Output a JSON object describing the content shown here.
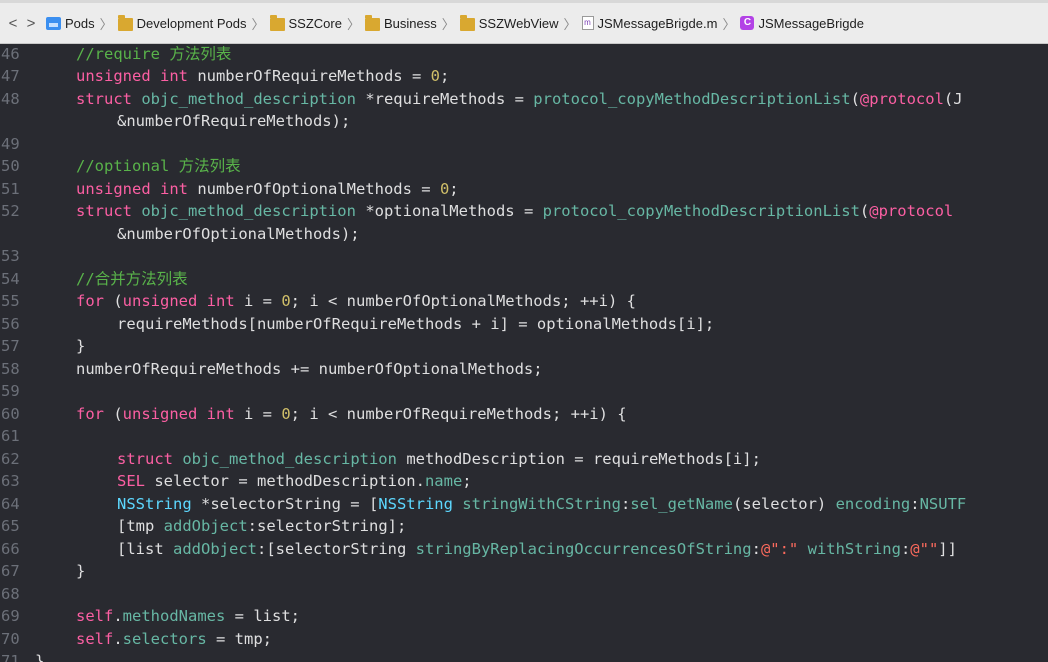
{
  "breadcrumb": {
    "back": "<",
    "forward": ">",
    "separator": "〉",
    "items": [
      {
        "label": "Pods",
        "icon": "project-icon"
      },
      {
        "label": "Development Pods",
        "icon": "folder-icon"
      },
      {
        "label": "SSZCore",
        "icon": "folder-icon"
      },
      {
        "label": "Business",
        "icon": "folder-icon"
      },
      {
        "label": "SSZWebView",
        "icon": "folder-icon"
      },
      {
        "label": "JSMessageBrigde.m",
        "icon": "objc-file-icon",
        "glyph": "m"
      },
      {
        "label": "JSMessageBrigde",
        "icon": "class-icon",
        "glyph": "C"
      }
    ]
  },
  "theme": {
    "background": "#292a30",
    "line_numbers": "#6c7079",
    "comment": "#59b34a",
    "keyword": "#fc5fa3",
    "number": "#d0bf69",
    "function": "#67b7a4",
    "type": "#5dd8ff",
    "string": "#fc6a5d",
    "plain": "#dfdfe0"
  },
  "editor": {
    "lines": [
      {
        "n": "46",
        "indent": 0,
        "tokens": [
          {
            "c": "comment",
            "t": "//require 方法列表"
          }
        ]
      },
      {
        "n": "47",
        "indent": 0,
        "tokens": [
          {
            "c": "kw",
            "t": "unsigned int"
          },
          {
            "c": "",
            "t": " numberOfRequireMethods = "
          },
          {
            "c": "num",
            "t": "0"
          },
          {
            "c": "",
            "t": ";"
          }
        ]
      },
      {
        "n": "48",
        "indent": 0,
        "tokens": [
          {
            "c": "kw",
            "t": "struct"
          },
          {
            "c": "",
            "t": " "
          },
          {
            "c": "fn",
            "t": "objc_method_description"
          },
          {
            "c": "",
            "t": " *requireMethods = "
          },
          {
            "c": "fn",
            "t": "protocol_copyMethodDescriptionList"
          },
          {
            "c": "",
            "t": "("
          },
          {
            "c": "kw",
            "t": "@protocol"
          },
          {
            "c": "",
            "t": "(J"
          }
        ]
      },
      {
        "n": "",
        "indent": 1,
        "tokens": [
          {
            "c": "",
            "t": "&numberOfRequireMethods);"
          }
        ]
      },
      {
        "n": "49",
        "indent": 0,
        "tokens": []
      },
      {
        "n": "50",
        "indent": 0,
        "tokens": [
          {
            "c": "comment",
            "t": "//optional 方法列表"
          }
        ]
      },
      {
        "n": "51",
        "indent": 0,
        "tokens": [
          {
            "c": "kw",
            "t": "unsigned int"
          },
          {
            "c": "",
            "t": " numberOfOptionalMethods = "
          },
          {
            "c": "num",
            "t": "0"
          },
          {
            "c": "",
            "t": ";"
          }
        ]
      },
      {
        "n": "52",
        "indent": 0,
        "tokens": [
          {
            "c": "kw",
            "t": "struct"
          },
          {
            "c": "",
            "t": " "
          },
          {
            "c": "fn",
            "t": "objc_method_description"
          },
          {
            "c": "",
            "t": " *optionalMethods = "
          },
          {
            "c": "fn",
            "t": "protocol_copyMethodDescriptionList"
          },
          {
            "c": "",
            "t": "("
          },
          {
            "c": "kw",
            "t": "@protocol"
          }
        ]
      },
      {
        "n": "",
        "indent": 1,
        "tokens": [
          {
            "c": "",
            "t": "&numberOfOptionalMethods);"
          }
        ]
      },
      {
        "n": "53",
        "indent": 0,
        "tokens": []
      },
      {
        "n": "54",
        "indent": 0,
        "tokens": [
          {
            "c": "comment",
            "t": "//合并方法列表"
          }
        ]
      },
      {
        "n": "55",
        "indent": 0,
        "tokens": [
          {
            "c": "kw",
            "t": "for"
          },
          {
            "c": "",
            "t": " ("
          },
          {
            "c": "kw",
            "t": "unsigned int"
          },
          {
            "c": "",
            "t": " i = "
          },
          {
            "c": "num",
            "t": "0"
          },
          {
            "c": "",
            "t": "; i < numberOfOptionalMethods; ++i) {"
          }
        ]
      },
      {
        "n": "56",
        "indent": 1,
        "tokens": [
          {
            "c": "",
            "t": "requireMethods[numberOfRequireMethods + i] = optionalMethods[i];"
          }
        ]
      },
      {
        "n": "57",
        "indent": 0,
        "tokens": [
          {
            "c": "",
            "t": "}"
          }
        ]
      },
      {
        "n": "58",
        "indent": 0,
        "tokens": [
          {
            "c": "",
            "t": "numberOfRequireMethods += numberOfOptionalMethods;"
          }
        ]
      },
      {
        "n": "59",
        "indent": 0,
        "tokens": []
      },
      {
        "n": "60",
        "indent": 0,
        "tokens": [
          {
            "c": "kw",
            "t": "for"
          },
          {
            "c": "",
            "t": " ("
          },
          {
            "c": "kw",
            "t": "unsigned int"
          },
          {
            "c": "",
            "t": " i = "
          },
          {
            "c": "num",
            "t": "0"
          },
          {
            "c": "",
            "t": "; i < numberOfRequireMethods; ++i) {"
          }
        ]
      },
      {
        "n": "61",
        "indent": 0,
        "tokens": []
      },
      {
        "n": "62",
        "indent": 1,
        "tokens": [
          {
            "c": "kw",
            "t": "struct"
          },
          {
            "c": "",
            "t": " "
          },
          {
            "c": "fn",
            "t": "objc_method_description"
          },
          {
            "c": "",
            "t": " methodDescription = requireMethods[i];"
          }
        ]
      },
      {
        "n": "63",
        "indent": 1,
        "tokens": [
          {
            "c": "kw",
            "t": "SEL"
          },
          {
            "c": "",
            "t": " selector = methodDescription."
          },
          {
            "c": "fn",
            "t": "name"
          },
          {
            "c": "",
            "t": ";"
          }
        ]
      },
      {
        "n": "64",
        "indent": 1,
        "tokens": [
          {
            "c": "type",
            "t": "NSString"
          },
          {
            "c": "",
            "t": " *selectorString = ["
          },
          {
            "c": "type",
            "t": "NSString"
          },
          {
            "c": "",
            "t": " "
          },
          {
            "c": "fn",
            "t": "stringWithCString"
          },
          {
            "c": "",
            "t": ":"
          },
          {
            "c": "fn",
            "t": "sel_getName"
          },
          {
            "c": "",
            "t": "(selector) "
          },
          {
            "c": "fn",
            "t": "encoding"
          },
          {
            "c": "",
            "t": ":"
          },
          {
            "c": "fn",
            "t": "NSUTF"
          }
        ]
      },
      {
        "n": "65",
        "indent": 1,
        "tokens": [
          {
            "c": "",
            "t": "[tmp "
          },
          {
            "c": "fn",
            "t": "addObject"
          },
          {
            "c": "",
            "t": ":selectorString];"
          }
        ]
      },
      {
        "n": "66",
        "indent": 1,
        "tokens": [
          {
            "c": "",
            "t": "[list "
          },
          {
            "c": "fn",
            "t": "addObject"
          },
          {
            "c": "",
            "t": ":[selectorString "
          },
          {
            "c": "fn",
            "t": "stringByReplacingOccurrencesOfString"
          },
          {
            "c": "",
            "t": ":"
          },
          {
            "c": "str",
            "t": "@\":\""
          },
          {
            "c": "",
            "t": " "
          },
          {
            "c": "fn",
            "t": "withString"
          },
          {
            "c": "",
            "t": ":"
          },
          {
            "c": "str",
            "t": "@\"\""
          },
          {
            "c": "",
            "t": "]]"
          }
        ]
      },
      {
        "n": "67",
        "indent": 0,
        "tokens": [
          {
            "c": "",
            "t": "}"
          }
        ]
      },
      {
        "n": "68",
        "indent": 0,
        "tokens": []
      },
      {
        "n": "69",
        "indent": 0,
        "tokens": [
          {
            "c": "kw",
            "t": "self"
          },
          {
            "c": "",
            "t": "."
          },
          {
            "c": "fn",
            "t": "methodNames"
          },
          {
            "c": "",
            "t": " = list;"
          }
        ]
      },
      {
        "n": "70",
        "indent": 0,
        "tokens": [
          {
            "c": "kw",
            "t": "self"
          },
          {
            "c": "",
            "t": "."
          },
          {
            "c": "fn",
            "t": "selectors"
          },
          {
            "c": "",
            "t": " = tmp;"
          }
        ]
      },
      {
        "n": "71",
        "indent": -1,
        "tokens": [
          {
            "c": "",
            "t": "}"
          }
        ]
      }
    ]
  }
}
